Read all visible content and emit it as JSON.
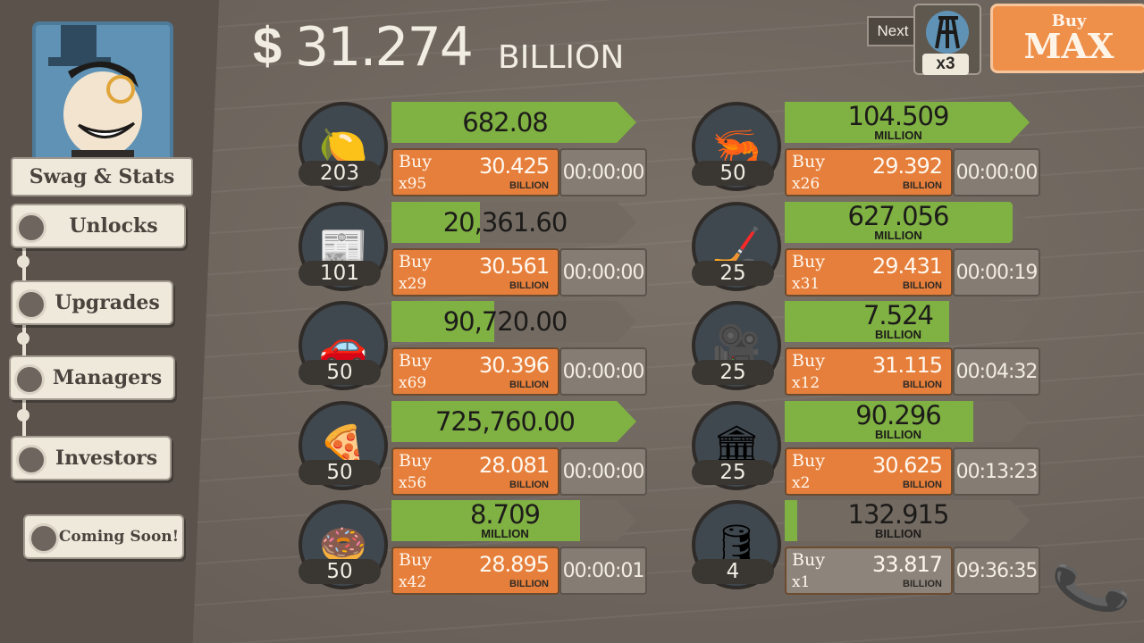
{
  "header": {
    "currency_symbol": "$",
    "money_value": "31.274",
    "money_unit": "BILLION",
    "next_label": "Next",
    "next_multiplier": "x3",
    "buy_label": "Buy",
    "buy_mode": "MAX"
  },
  "sidebar": {
    "profile_label": "Swag & Stats",
    "items": [
      {
        "label": "Unlocks"
      },
      {
        "label": "Upgrades"
      },
      {
        "label": "Managers"
      },
      {
        "label": "Investors"
      },
      {
        "label": "Coming Soon!"
      }
    ]
  },
  "businesses": [
    {
      "icon": "lemon-icon",
      "glyph": "🍋",
      "owned": "203",
      "revenue": "682.08",
      "revenue_unit": "",
      "progress": 1.0,
      "buy_word": "Buy",
      "buy_qty": "x95",
      "cost": "30.425",
      "cost_unit": "BILLION",
      "timer": "00:00:00",
      "affordable": true
    },
    {
      "icon": "newspaper-icon",
      "glyph": "📰",
      "owned": "101",
      "revenue": "20,361.60",
      "revenue_unit": "",
      "progress": 0.36,
      "buy_word": "Buy",
      "buy_qty": "x29",
      "cost": "30.561",
      "cost_unit": "BILLION",
      "timer": "00:00:00",
      "affordable": true
    },
    {
      "icon": "car-wash-icon",
      "glyph": "🚗",
      "owned": "50",
      "revenue": "90,720.00",
      "revenue_unit": "",
      "progress": 0.42,
      "buy_word": "Buy",
      "buy_qty": "x69",
      "cost": "30.396",
      "cost_unit": "BILLION",
      "timer": "00:00:00",
      "affordable": true
    },
    {
      "icon": "pizza-icon",
      "glyph": "🍕",
      "owned": "50",
      "revenue": "725,760.00",
      "revenue_unit": "",
      "progress": 1.0,
      "buy_word": "Buy",
      "buy_qty": "x56",
      "cost": "28.081",
      "cost_unit": "BILLION",
      "timer": "00:00:00",
      "affordable": true
    },
    {
      "icon": "donut-icon",
      "glyph": "🍩",
      "owned": "50",
      "revenue": "8.709",
      "revenue_unit": "MILLION",
      "progress": 0.77,
      "buy_word": "Buy",
      "buy_qty": "x42",
      "cost": "28.895",
      "cost_unit": "BILLION",
      "timer": "00:00:01",
      "affordable": true
    },
    {
      "icon": "shrimp-icon",
      "glyph": "🦐",
      "owned": "50",
      "revenue": "104.509",
      "revenue_unit": "MILLION",
      "progress": 1.0,
      "buy_word": "Buy",
      "buy_qty": "x26",
      "cost": "29.392",
      "cost_unit": "BILLION",
      "timer": "00:00:00",
      "affordable": true
    },
    {
      "icon": "hockey-icon",
      "glyph": "🏒",
      "owned": "25",
      "revenue": "627.056",
      "revenue_unit": "MILLION",
      "progress": 0.93,
      "buy_word": "Buy",
      "buy_qty": "x31",
      "cost": "29.431",
      "cost_unit": "BILLION",
      "timer": "00:00:19",
      "affordable": true
    },
    {
      "icon": "movie-camera-icon",
      "glyph": "🎥",
      "owned": "25",
      "revenue": "7.524",
      "revenue_unit": "BILLION",
      "progress": 0.67,
      "buy_word": "Buy",
      "buy_qty": "x12",
      "cost": "31.115",
      "cost_unit": "BILLION",
      "timer": "00:04:32",
      "affordable": true
    },
    {
      "icon": "bank-icon",
      "glyph": "🏛",
      "owned": "25",
      "revenue": "90.296",
      "revenue_unit": "BILLION",
      "progress": 0.77,
      "buy_word": "Buy",
      "buy_qty": "x2",
      "cost": "30.625",
      "cost_unit": "BILLION",
      "timer": "00:13:23",
      "affordable": true
    },
    {
      "icon": "oil-rig-icon",
      "glyph": "🛢",
      "owned": "4",
      "revenue": "132.915",
      "revenue_unit": "BILLION",
      "progress": 0.05,
      "buy_word": "Buy",
      "buy_qty": "x1",
      "cost": "33.817",
      "cost_unit": "BILLION",
      "timer": "09:36:35",
      "affordable": false
    }
  ],
  "phone": {
    "glyph": "📞"
  }
}
